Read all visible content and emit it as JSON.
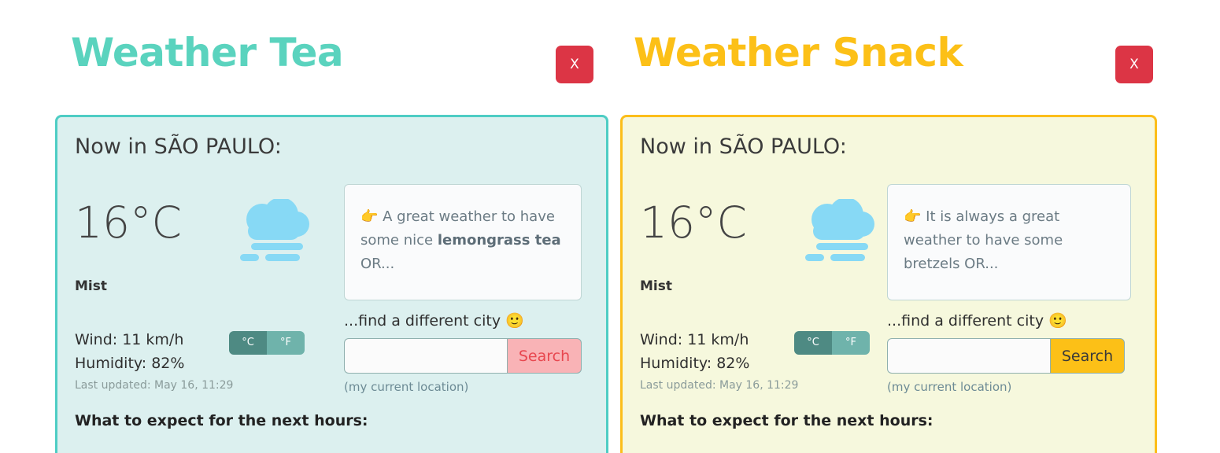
{
  "panels": [
    {
      "id": "weather-tea",
      "app_title": "Weather Tea",
      "title_color": "#5ad3be",
      "close_label": "X",
      "card": {
        "heading": "Now in SÃO PAULO:",
        "temperature": "16°C",
        "condition": "Mist",
        "weather_icon": "mist-cloud-icon",
        "wind": "Wind: 11 km/h",
        "humidity": "Humidity: 82%",
        "last_updated": "Last updated: May 16, 11:29",
        "expect": "What to expect for the next hours:",
        "units": {
          "celsius": "°C",
          "fahrenheit": "°F",
          "active": "°C"
        },
        "tip": {
          "pointer": "👉",
          "text_before": " A great weather to have some nice ",
          "highlight": "lemongrass tea",
          "text_after": " OR..."
        },
        "find_city": "...find a different city 🙂",
        "search_value": "",
        "search_placeholder": "",
        "search_label": "Search",
        "current_location": "(my current location)",
        "accent": "#4ecdc4",
        "background": "#dcf0ef",
        "search_button_color": "#f9b3b6"
      }
    },
    {
      "id": "weather-snack",
      "app_title": "Weather Snack",
      "title_color": "#fcc017",
      "close_label": "X",
      "card": {
        "heading": "Now in SÃO PAULO:",
        "temperature": "16°C",
        "condition": "Mist",
        "weather_icon": "mist-cloud-icon",
        "wind": "Wind: 11 km/h",
        "humidity": "Humidity: 82%",
        "last_updated": "Last updated: May 16, 11:29",
        "expect": "What to expect for the next hours:",
        "units": {
          "celsius": "°C",
          "fahrenheit": "°F",
          "active": "°C"
        },
        "tip": {
          "pointer": "👉",
          "text_before": " It is always a great weather to have some bretzels OR...",
          "highlight": "",
          "text_after": ""
        },
        "find_city": "...find a different city 🙂",
        "search_value": "",
        "search_placeholder": "",
        "search_label": "Search",
        "current_location": "(my current location)",
        "accent": "#fcbe1a",
        "background": "#f6f8dd",
        "search_button_color": "#fcc017"
      }
    }
  ]
}
